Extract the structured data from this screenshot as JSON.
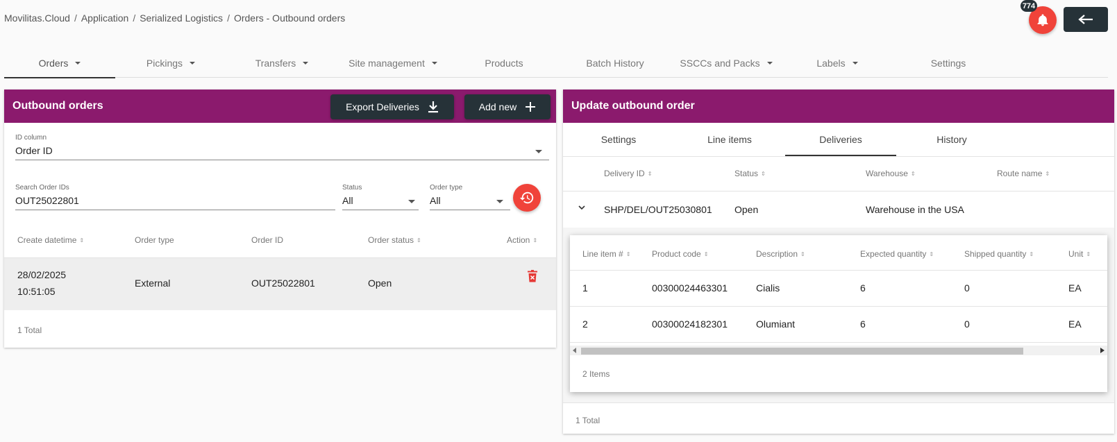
{
  "breadcrumb": [
    "Movilitas.Cloud",
    "Application",
    "Serialized Logistics",
    "Orders - Outbound orders"
  ],
  "notifications": {
    "count": "774",
    "icon": "bell-icon"
  },
  "nav": [
    {
      "label": "Orders",
      "dropdown": true,
      "active": true
    },
    {
      "label": "Pickings",
      "dropdown": true
    },
    {
      "label": "Transfers",
      "dropdown": true
    },
    {
      "label": "Site management",
      "dropdown": true
    },
    {
      "label": "Products",
      "dropdown": false
    },
    {
      "label": "Batch History",
      "dropdown": false
    },
    {
      "label": "SSCCs and Packs",
      "dropdown": true
    },
    {
      "label": "Labels",
      "dropdown": true
    },
    {
      "label": "Settings",
      "dropdown": false
    }
  ],
  "colors": {
    "header": "#8b1a6d",
    "dark_button": "#263238",
    "accent_red": "#f0433a"
  },
  "left": {
    "title": "Outbound orders",
    "export_label": "Export Deliveries",
    "add_label": "Add new",
    "id_column": {
      "label": "ID column",
      "value": "Order ID"
    },
    "search": {
      "label": "Search Order IDs",
      "value": "OUT25022801"
    },
    "status": {
      "label": "Status",
      "value": "All"
    },
    "order_type": {
      "label": "Order type",
      "value": "All"
    },
    "columns": [
      "Create datetime",
      "Order type",
      "Order ID",
      "Order status",
      "Action"
    ],
    "rows": [
      {
        "date": "28/02/2025",
        "time": "10:51:05",
        "type": "External",
        "id": "OUT25022801",
        "status": "Open"
      }
    ],
    "total": "1 Total"
  },
  "right": {
    "title": "Update outbound order",
    "tabs": [
      "Settings",
      "Line items",
      "Deliveries",
      "History"
    ],
    "active_tab": "Deliveries",
    "columns": [
      "Delivery ID",
      "Status",
      "Warehouse",
      "Route name"
    ],
    "delivery": {
      "id": "SHP/DEL/OUT25030801",
      "status": "Open",
      "warehouse": "Warehouse in the USA"
    },
    "line_columns": [
      "Line item #",
      "Product code",
      "Description",
      "Expected quantity",
      "Shipped quantity",
      "Unit"
    ],
    "lines": [
      {
        "no": "1",
        "code": "00300024463301",
        "desc": "Cialis",
        "expected": "6",
        "shipped": "0",
        "unit": "EA"
      },
      {
        "no": "2",
        "code": "00300024182301",
        "desc": "Olumiant",
        "expected": "6",
        "shipped": "0",
        "unit": "EA"
      }
    ],
    "items_total": "2 Items",
    "total": "1 Total"
  }
}
